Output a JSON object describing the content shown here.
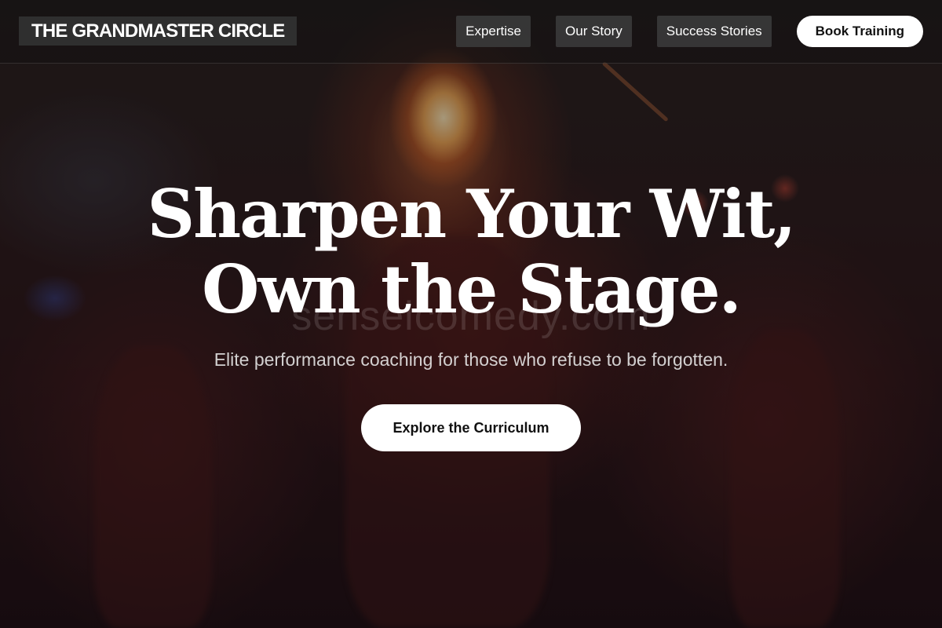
{
  "brand": {
    "logo_text": "THE GRANDMASTER CIRCLE"
  },
  "nav": {
    "items": [
      {
        "label": "Expertise"
      },
      {
        "label": "Our Story"
      },
      {
        "label": "Success Stories"
      }
    ],
    "cta_label": "Book Training"
  },
  "hero": {
    "headline_line1": "Sharpen Your Wit,",
    "headline_line2": "Own the Stage.",
    "watermark": "senseicomedy.com",
    "subheadline": "Elite performance coaching for those who refuse to be forgotten.",
    "cta_label": "Explore the Curriculum",
    "background_image": "fire-performer-crowd-photo"
  },
  "colors": {
    "text_primary": "#ffffff",
    "button_bg": "#ffffff",
    "button_text": "#111111",
    "nav_pill_bg": "#3c3c3c",
    "logo_bg": "#2f2f2f",
    "overlay": "#0c060a"
  }
}
